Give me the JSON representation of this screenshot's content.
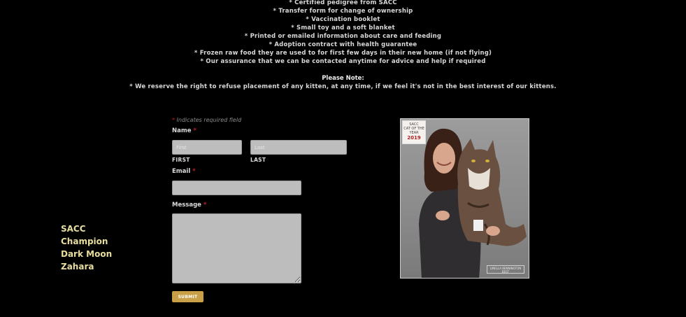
{
  "included_items": [
    "* Certified pedigree from SACC",
    "* Transfer form for change of ownership",
    "* Vaccination booklet",
    "* Small toy and a soft blanket",
    "* Printed or emailed information about care and feeding",
    "* Adoption contract with health guarantee",
    "* Frozen raw food they are used to for first few days in their new home (if not flying)",
    "* Our assurance that we can be contacted anytime for advice and help if required"
  ],
  "note": {
    "title": "Please Note:",
    "text": "* We reserve the right to refuse placement of any kitten, at any time, if we feel it's not in the best interest of our kittens."
  },
  "form": {
    "required_star": "*",
    "required_note": "Indicates required field",
    "name_label": "Name",
    "first_placeholder": "First",
    "last_placeholder": "Last",
    "first_sublabel": "FIRST",
    "last_sublabel": "LAST",
    "email_label": "Email",
    "message_label": "Message",
    "submit_label": "SUBMIT"
  },
  "caption_lines": [
    "SACC",
    "Champion",
    "Dark Moon",
    "Zahara"
  ],
  "photo": {
    "badge_title": "SACC",
    "badge_sub": "CAT OF THE YEAR",
    "badge_year": "2019",
    "watermark": "LINELLA BENNINGTON BEST"
  },
  "colors": {
    "background": "#000000",
    "caption": "#e7de9e",
    "submit": "#c9a048",
    "required": "#c0202a"
  }
}
